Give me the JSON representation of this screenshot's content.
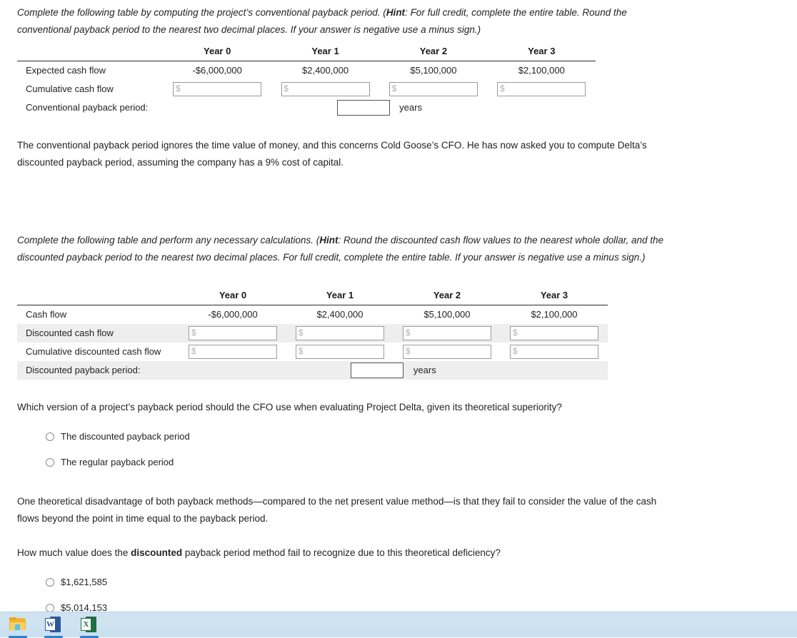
{
  "question_1": {
    "prompt_parts": {
      "lead": "Complete the following table by computing the project’s conventional payback period. (",
      "hint_label": "Hint",
      "hint_body": ": For full credit, complete the entire table. Round the conventional payback period to the nearest two decimal places. If your answer is negative use a minus sign.)"
    },
    "table": {
      "columns": [
        "Year 0",
        "Year 1",
        "Year 2",
        "Year 3"
      ],
      "rows": [
        {
          "label": "Expected cash flow",
          "type": "values",
          "values": [
            "-$6,000,000",
            "$2,400,000",
            "$5,100,000",
            "$2,100,000"
          ]
        },
        {
          "label": "Cumulative cash flow",
          "type": "inputs",
          "placeholders": [
            "$",
            "$",
            "$",
            "$"
          ],
          "values": [
            "",
            "",
            "",
            ""
          ]
        }
      ],
      "payback_row": {
        "label": "Conventional payback period:",
        "input_value": "",
        "unit": "years"
      }
    }
  },
  "interstitial": {
    "text": "The conventional payback period ignores the time value of money, and this concerns Cold Goose’s CFO. He has now asked you to compute Delta’s discounted payback period, assuming the company has a 9% cost of capital."
  },
  "question_2": {
    "prompt_parts": {
      "lead": "Complete the following table and perform any necessary calculations. (",
      "hint_label": "Hint",
      "hint_body": ": Round the discounted cash flow values to the nearest whole dollar, and the discounted payback period to the nearest two decimal places. For full credit, complete the entire table. If your answer is negative use a minus sign.)"
    },
    "table": {
      "columns": [
        "Year 0",
        "Year 1",
        "Year 2",
        "Year 3"
      ],
      "rows": [
        {
          "label": "Cash flow",
          "type": "values",
          "shaded": false,
          "values": [
            "-$6,000,000",
            "$2,400,000",
            "$5,100,000",
            "$2,100,000"
          ]
        },
        {
          "label": "Discounted cash flow",
          "type": "inputs",
          "shaded": true,
          "placeholders": [
            "$",
            "$",
            "$",
            "$"
          ],
          "values": [
            "",
            "",
            "",
            ""
          ]
        },
        {
          "label": "Cumulative discounted cash flow",
          "type": "inputs",
          "shaded": false,
          "placeholders": [
            "$",
            "$",
            "$",
            "$"
          ],
          "values": [
            "",
            "",
            "",
            ""
          ]
        }
      ],
      "payback_row": {
        "label": "Discounted payback period:",
        "shaded": true,
        "input_value": "",
        "unit": "years"
      }
    }
  },
  "question_3": {
    "prompt": "Which version of a project’s payback period should the CFO use when evaluating Project Delta, given its theoretical superiority?",
    "options": [
      {
        "label": "The discounted payback period",
        "selected": false
      },
      {
        "label": "The regular payback period",
        "selected": false
      }
    ]
  },
  "statement": {
    "text": "One theoretical disadvantage of both payback methods—compared to the net present value method—is that they fail to consider the value of the cash flows beyond the point in time equal to the payback period."
  },
  "question_4": {
    "prompt_parts": {
      "lead": "How much value does the ",
      "bold": "discounted",
      "tail": " payback period method fail to recognize due to this theoretical deficiency?"
    },
    "options": [
      {
        "label": "$1,621,585",
        "selected": false
      },
      {
        "label": "$5,014,153",
        "selected": false
      }
    ]
  },
  "taskbar": {
    "items": [
      {
        "name": "file-explorer",
        "letter": "",
        "active": true
      },
      {
        "name": "microsoft-word",
        "letter": "W",
        "active": true
      },
      {
        "name": "microsoft-excel",
        "letter": "X",
        "active": true
      }
    ]
  }
}
